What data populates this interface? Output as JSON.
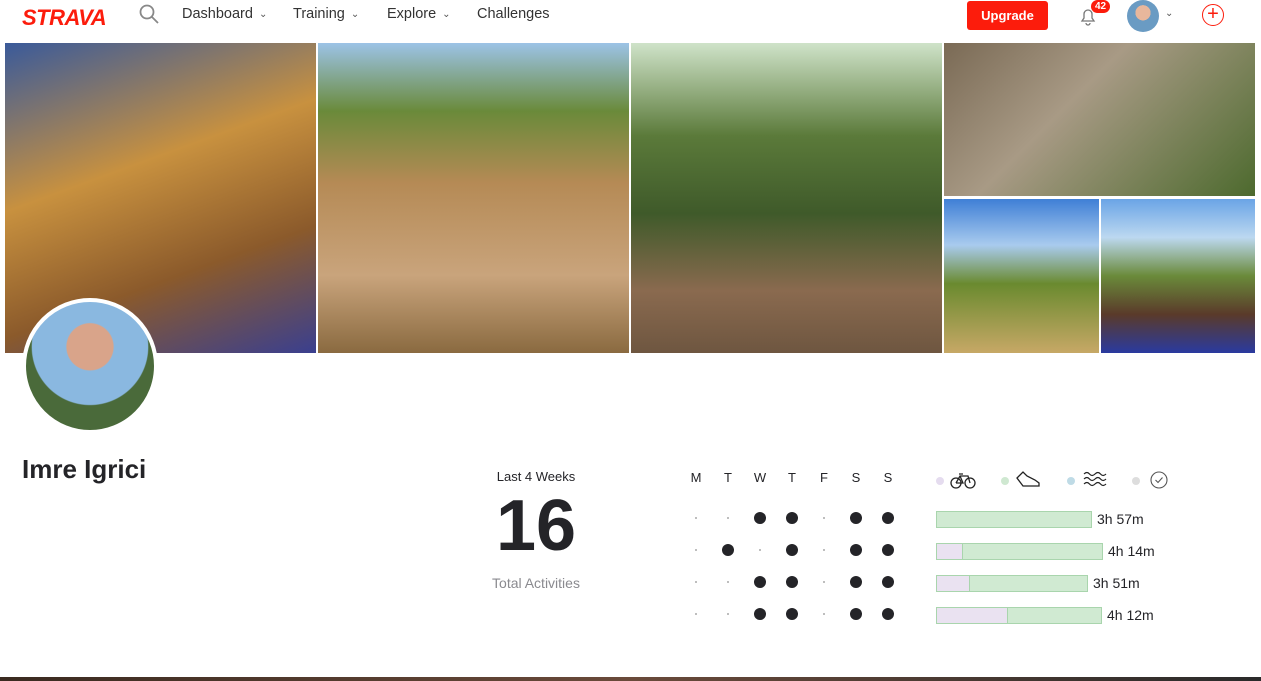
{
  "nav": {
    "logo": "STRAVA",
    "items": [
      {
        "label": "Dashboard"
      },
      {
        "label": "Training"
      },
      {
        "label": "Explore"
      },
      {
        "label": "Challenges"
      }
    ],
    "upgrade": "Upgrade",
    "notification_count": "42",
    "accent": "#fc1c0c"
  },
  "profile": {
    "name": "Imre Igrici"
  },
  "stats": {
    "period": "Last 4 Weeks",
    "total": "16",
    "total_label": "Total Activities"
  },
  "week_days": [
    "M",
    "T",
    "W",
    "T",
    "F",
    "S",
    "S"
  ],
  "activity_grid": [
    [
      0,
      0,
      1,
      1,
      0,
      1,
      1
    ],
    [
      0,
      1,
      0,
      1,
      0,
      1,
      1
    ],
    [
      0,
      0,
      1,
      1,
      0,
      1,
      1
    ],
    [
      0,
      0,
      1,
      1,
      0,
      1,
      1
    ]
  ],
  "legend": [
    {
      "icon": "bike-icon",
      "color": "#e5dcef"
    },
    {
      "icon": "shoe-icon",
      "color": "#cfe8d1"
    },
    {
      "icon": "swim-icon",
      "color": "#bfdbe6"
    },
    {
      "icon": "clock-icon",
      "color": "#dddddd"
    }
  ],
  "weeks": [
    {
      "time": "3h 57m",
      "ride_fraction": 0,
      "minutes": 237
    },
    {
      "time": "4h 14m",
      "ride_fraction": 0.16,
      "minutes": 254
    },
    {
      "time": "3h 51m",
      "ride_fraction": 0.22,
      "minutes": 231
    },
    {
      "time": "4h 12m",
      "ride_fraction": 0.43,
      "minutes": 252
    }
  ]
}
